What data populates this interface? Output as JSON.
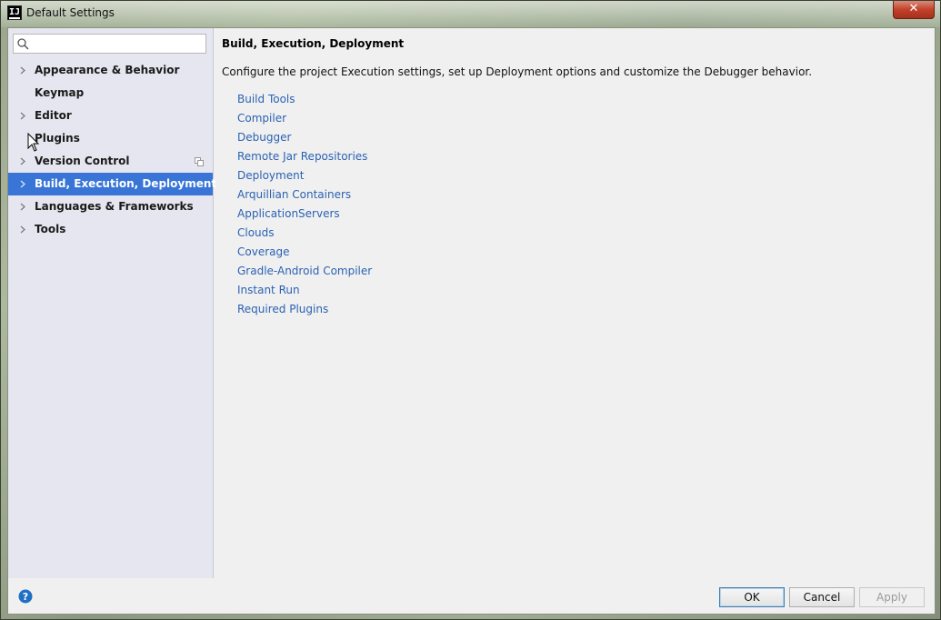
{
  "window": {
    "title": "Default Settings",
    "app_icon_text": "IJ",
    "close_glyph": "✕"
  },
  "search": {
    "value": "",
    "placeholder": ""
  },
  "sidebar": {
    "items": [
      {
        "label": "Appearance & Behavior",
        "expandable": true,
        "selected": false
      },
      {
        "label": "Keymap",
        "expandable": false,
        "selected": false
      },
      {
        "label": "Editor",
        "expandable": true,
        "selected": false
      },
      {
        "label": "Plugins",
        "expandable": false,
        "selected": false
      },
      {
        "label": "Version Control",
        "expandable": true,
        "selected": false,
        "has_copy_icon": true
      },
      {
        "label": "Build, Execution, Deployment",
        "expandable": true,
        "selected": true
      },
      {
        "label": "Languages & Frameworks",
        "expandable": true,
        "selected": false
      },
      {
        "label": "Tools",
        "expandable": true,
        "selected": false
      }
    ]
  },
  "main": {
    "title": "Build, Execution, Deployment",
    "description": "Configure the project Execution settings, set up Deployment options and customize the Debugger behavior.",
    "links": [
      "Build Tools",
      "Compiler",
      "Debugger",
      "Remote Jar Repositories",
      "Deployment",
      "Arquillian Containers",
      "ApplicationServers",
      "Clouds",
      "Coverage",
      "Gradle-Android Compiler",
      "Instant Run",
      "Required Plugins"
    ]
  },
  "footer": {
    "help_glyph": "?",
    "ok_label": "OK",
    "cancel_label": "Cancel",
    "apply_label": "Apply"
  },
  "colors": {
    "selection": "#3875d7",
    "link": "#2b62b3",
    "sidebar_bg": "#e6e6f0",
    "panel_bg": "#f0f0f0"
  },
  "icons": {
    "search": "search-icon",
    "arrow": "chevron-right-icon",
    "copy": "copy-icon",
    "help": "help-icon",
    "close": "close-icon",
    "cursor": "mouse-cursor-icon"
  }
}
